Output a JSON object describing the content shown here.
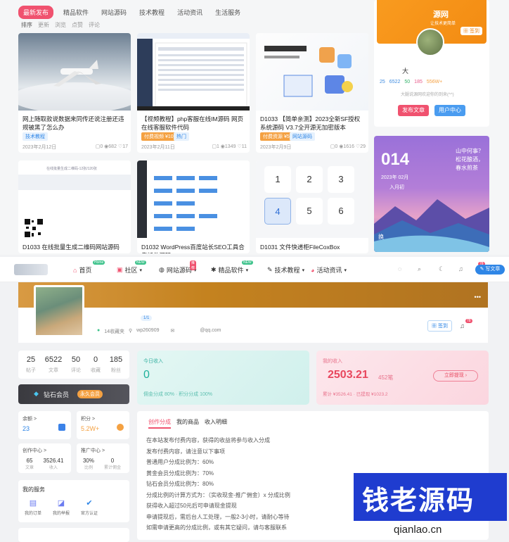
{
  "tabs": [
    "最新发布",
    "精品软件",
    "网站源码",
    "技术教程",
    "活动资讯",
    "生活服务"
  ],
  "sorts": [
    "排序",
    "更新",
    "浏览",
    "点赞",
    "评论"
  ],
  "cards": [
    {
      "title": "网上随取款说数据来同传还说注册还违规被黑了怎么办",
      "tag": "技术教程",
      "date": "2023年2月12日",
      "comments": "0",
      "views": "682",
      "likes": "17"
    },
    {
      "title": "【视频教程】php客服在线IM源码 网页在线客服软件代码",
      "tag": "技术教程",
      "tag2": "热门",
      "tag1": "付费视频 ¥10",
      "date": "2023年2月11日",
      "comments": "1",
      "views": "1349",
      "likes": "11"
    },
    {
      "title": "D1033 【简单亲测】2023全新SF授权系统源码 V3.7全开源无加密版本",
      "tag1": "付费资源 ¥5",
      "tag": "网站源码",
      "date": "2023年2月9日",
      "comments": "0",
      "views": "1616",
      "likes": "29"
    },
    {
      "title": "D1033 在线批量生成二维码网站源码",
      "thumb_text": "在线批量生成二维码-12张/120张",
      "date": "",
      "comments": "",
      "views": "",
      "likes": ""
    },
    {
      "title": "D1032 WordPress百度站长SEO工具合集插件源码",
      "date": "",
      "comments": "",
      "views": "",
      "likes": ""
    },
    {
      "title": "D1031 文件快递柜FileCoxBox",
      "numpad": [
        "1",
        "2",
        "3",
        "4",
        "5",
        "6",
        "7",
        "8",
        "9"
      ],
      "date": "",
      "comments": "",
      "views": "",
      "likes": ""
    }
  ],
  "profile_card": {
    "banner_text": "源网",
    "banner_sub": "让技术更简单",
    "sign_label": "签到",
    "name": "大",
    "stats": [
      "25",
      "6522",
      "50",
      "185",
      "556W+"
    ],
    "desc": "大腿说源网欢迎你的到来(^^)",
    "publish": "发布文章",
    "center": "用户中心"
  },
  "date_banner": {
    "day": "014",
    "date": "2023年 02月",
    "lunar": "入月初",
    "poem": "山中何事？ 松花酿酒，春水煎茶",
    "side": "换"
  },
  "nav": {
    "items": [
      {
        "label": "首页",
        "tag": "Home"
      },
      {
        "label": "社区",
        "tag": "NEW"
      },
      {
        "label": "网站源码",
        "tag": "推荐"
      },
      {
        "label": "精品软件",
        "tag": "NEW"
      },
      {
        "label": "技术教程",
        "tag": ""
      },
      {
        "label": "活动资讯",
        "tag": ""
      }
    ],
    "notify": "78",
    "write": "写文章"
  },
  "profile": {
    "level": "LV",
    "collect": "14收藏夹",
    "uid": "wp260909",
    "email": "@qq.com",
    "sign": "签到",
    "notify": "78",
    "vip": "1/1"
  },
  "stats": [
    {
      "n": "25",
      "l": "帖子"
    },
    {
      "n": "6522",
      "l": "文章"
    },
    {
      "n": "50",
      "l": "评论"
    },
    {
      "n": "0",
      "l": "收藏"
    },
    {
      "n": "185",
      "l": "粉丝"
    }
  ],
  "vip": {
    "label": "钻石会员",
    "tag": "永久会员"
  },
  "balance": {
    "label": "余额 >",
    "value": "23"
  },
  "points": {
    "label": "积分 >",
    "value": "5.2W+"
  },
  "creator": {
    "label": "创作中心 >",
    "items": [
      {
        "n": "65",
        "l": "文章"
      },
      {
        "n": "3526.41",
        "l": "收入"
      }
    ]
  },
  "promo": {
    "label": "推广中心 >",
    "items": [
      {
        "n": "30%",
        "l": "比例"
      },
      {
        "n": "0",
        "l": "累计佣金"
      }
    ]
  },
  "services": {
    "title": "我的服务",
    "items": [
      "我的订单",
      "我的举报",
      "官方认证"
    ]
  },
  "today": {
    "label": "今日收入",
    "value": "0",
    "sub": "佣金分成 80% · 积分分成 100%"
  },
  "total": {
    "label": "我的收入",
    "value": "2503.21",
    "unit": "452笔",
    "sub": "累计 ¥3526.41 · 已提现 ¥1023.2",
    "btn": "立即提现"
  },
  "income_tabs": [
    "创作分成",
    "我的商品",
    "收入明细"
  ],
  "policy": [
    "在本站发布付费内容，获得的收益将参与收入分成",
    "发布付费内容，请注意以下事项",
    "普通用户分成比例为：60%",
    "黄金会员分成比例为：70%",
    "钻石会员分成比例为：80%",
    "分成比例的计算方式为：（实收现金-推广佣金）x 分成比例",
    "获得收入超过50元后可申请现金提现",
    "申请提现后，需后台人工处理，一般2-3小时，请耐心等待",
    "如需申请更高的分成比例，或有其它疑问，请与客服联系"
  ],
  "watermark": {
    "cn": "钱老源码",
    "url": "qianlao.cn"
  },
  "colors": {
    "accent": "#f0526f",
    "blue": "#2f86e6",
    "orange": "#f4a142",
    "brand": "#1f3ccf"
  }
}
